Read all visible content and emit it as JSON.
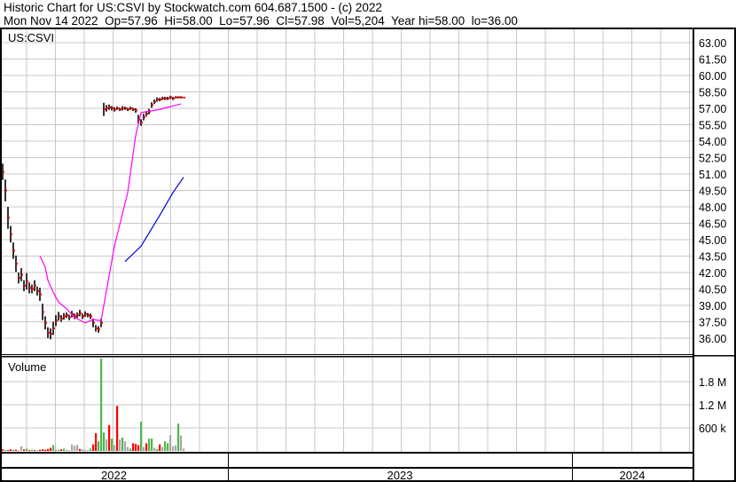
{
  "header": {
    "title": "Historic Chart for US:CSVI by Stockwatch.com 604.687.1500 - (c) 2022",
    "quote": "Mon Nov 14 2022  Op=57.96  Hi=58.00  Lo=57.96  Cl=57.98  Vol=5,204  Year hi=58.00  lo=36.00"
  },
  "colors": {
    "up": "#4cb84c",
    "down": "#ff0000",
    "neutral": "#a8a8a8",
    "ma_short": "#ff00ff",
    "ma_long": "#0000e0",
    "grid": "#c8c8c8",
    "bar": "#000000"
  },
  "chart_data": {
    "type": "line",
    "title": "US:CSVI",
    "price_axis": {
      "ticks": [
        "63.00",
        "61.50",
        "60.00",
        "58.50",
        "57.00",
        "55.50",
        "54.00",
        "52.50",
        "51.00",
        "49.50",
        "48.00",
        "46.50",
        "45.00",
        "43.50",
        "42.00",
        "40.50",
        "39.00",
        "37.50",
        "36.00"
      ],
      "ylim": [
        36,
        63
      ]
    },
    "volume_label": "Volume",
    "volume_axis": {
      "ticks": [
        "1.8 M",
        "1.2 M",
        "600 k"
      ],
      "values": [
        1800,
        1200,
        600
      ]
    },
    "x_labels": [
      "2022",
      "2023",
      "2024"
    ],
    "close": [
      51.2,
      49.5,
      47,
      45.5,
      44,
      42.8,
      41.5,
      41.8,
      40.8,
      41.2,
      40.6,
      40.5,
      40.8,
      40.3,
      40.0,
      38.4,
      37.4,
      36.5,
      36.4,
      36.9,
      37.6,
      38.0,
      37.8,
      38.0,
      38.1,
      37.9,
      38.2,
      38.0,
      38.1,
      38.3,
      38.0,
      38.2,
      38.1,
      38.0,
      37.4,
      36.9,
      36.8,
      37.4,
      56.9,
      57.0,
      57.1,
      57.0,
      56.9,
      57.0,
      56.9,
      57.0,
      57.0,
      56.9,
      57.0,
      56.9,
      56.8,
      56.0,
      55.7,
      56.2,
      56.5,
      56.7,
      57.3,
      57.6,
      57.8,
      57.8,
      57.9,
      57.9,
      57.9,
      58.0,
      57.9,
      58.0,
      58.0,
      58.0,
      57.98
    ],
    "spread": [
      1.5,
      2,
      2,
      1.5,
      1.5,
      1.5,
      1,
      1.2,
      1,
      1.5,
      1,
      0.8,
      1,
      0.8,
      1.2,
      1.5,
      1.2,
      1,
      1,
      1.2,
      1,
      0.8,
      0.6,
      0.6,
      0.5,
      0.5,
      0.6,
      0.5,
      0.5,
      0.6,
      0.5,
      0.5,
      0.4,
      0.5,
      0.8,
      0.6,
      0.6,
      0.8,
      1.2,
      0.6,
      0.5,
      0.4,
      0.4,
      0.3,
      0.3,
      0.4,
      0.3,
      0.3,
      0.3,
      0.3,
      0.4,
      0.8,
      0.6,
      0.6,
      0.5,
      0.5,
      0.5,
      0.4,
      0.4,
      0.3,
      0.3,
      0.3,
      0.3,
      0.3,
      0.3,
      0.2,
      0.2,
      0.2,
      0.1
    ],
    "volume_k": [
      40,
      20,
      20,
      40,
      30,
      30,
      20,
      120,
      40,
      60,
      20,
      30,
      20,
      20,
      30,
      40,
      30,
      50,
      80,
      150,
      40,
      30,
      40,
      60,
      30,
      20,
      170,
      130,
      160,
      50,
      40,
      30,
      20,
      60,
      170,
      460,
      250,
      2400,
      480,
      300,
      670,
      320,
      150,
      1170,
      300,
      350,
      250,
      100,
      60,
      200,
      180,
      150,
      760,
      100,
      200,
      320,
      320,
      80,
      50,
      170,
      100,
      250,
      200,
      410,
      120,
      150,
      710,
      400,
      60
    ],
    "volume_dir": [
      "d",
      "u",
      "d",
      "d",
      "u",
      "d",
      "n",
      "n",
      "d",
      "u",
      "d",
      "u",
      "d",
      "n",
      "d",
      "d",
      "d",
      "d",
      "d",
      "u",
      "n",
      "u",
      "d",
      "u",
      "n",
      "n",
      "n",
      "n",
      "n",
      "d",
      "n",
      "n",
      "n",
      "u",
      "d",
      "d",
      "u",
      "u",
      "u",
      "n",
      "d",
      "u",
      "n",
      "d",
      "n",
      "u",
      "n",
      "n",
      "u",
      "d",
      "d",
      "d",
      "u",
      "n",
      "d",
      "u",
      "u",
      "n",
      "u",
      "d",
      "n",
      "u",
      "u",
      "n",
      "n",
      "n",
      "u",
      "n",
      "n"
    ],
    "ma_short": [
      [
        14,
        43.5
      ],
      [
        16,
        42.5
      ],
      [
        17,
        41.3
      ],
      [
        19,
        40.2
      ],
      [
        21,
        39.3
      ],
      [
        24,
        38.7
      ],
      [
        27,
        37.9
      ],
      [
        31,
        37.4
      ],
      [
        34,
        37.7
      ],
      [
        37,
        37.6
      ],
      [
        42,
        44.4
      ],
      [
        47,
        49.3
      ],
      [
        50,
        54.5
      ],
      [
        52,
        56.6
      ],
      [
        59,
        56.9
      ],
      [
        67,
        57.4
      ]
    ],
    "ma_long": [
      [
        46,
        43.0
      ],
      [
        52,
        44.4
      ],
      [
        59,
        47.2
      ],
      [
        64,
        49.3
      ],
      [
        68,
        50.7
      ]
    ]
  }
}
